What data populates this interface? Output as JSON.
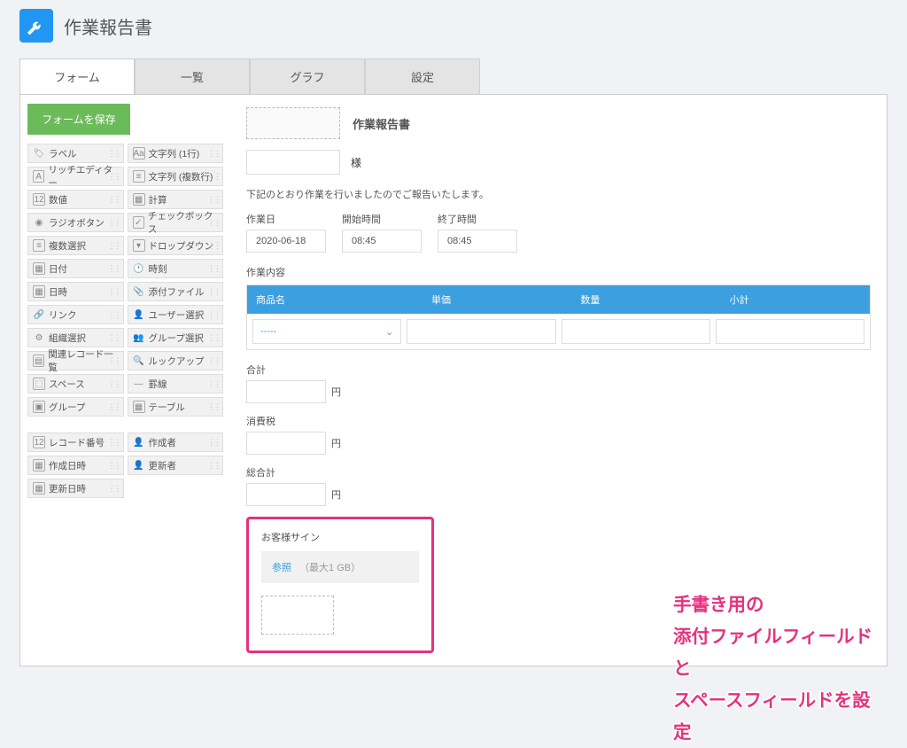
{
  "header": {
    "title": "作業報告書"
  },
  "tabs": {
    "form": "フォーム",
    "list": "一覧",
    "graph": "グラフ",
    "settings": "設定"
  },
  "sidebar": {
    "save": "フォームを保存",
    "fields": {
      "label": "ラベル",
      "text1": "文字列 (1行)",
      "rich": "リッチエディター",
      "textm": "文字列 (複数行)",
      "num": "数値",
      "calc": "計算",
      "radio": "ラジオボタン",
      "check": "チェックボックス",
      "multi": "複数選択",
      "drop": "ドロップダウン",
      "date": "日付",
      "time": "時刻",
      "datetime": "日時",
      "attach": "添付ファイル",
      "link": "リンク",
      "user": "ユーザー選択",
      "org": "組織選択",
      "group": "グループ選択",
      "related": "関連レコード一覧",
      "lookup": "ルックアップ",
      "space": "スペース",
      "hr": "罫線",
      "grp": "グループ",
      "tbl": "テーブル",
      "recno": "レコード番号",
      "creator": "作成者",
      "ctime": "作成日時",
      "updater": "更新者",
      "utime": "更新日時"
    }
  },
  "doc": {
    "title": "作業報告書",
    "sama": "様",
    "desc": "下記のとおり作業を行いましたのでご報告いたします。",
    "workDate": {
      "label": "作業日",
      "value": "2020-06-18"
    },
    "startTime": {
      "label": "開始時間",
      "value": "08:45"
    },
    "endTime": {
      "label": "終了時間",
      "value": "08:45"
    },
    "workContent": "作業内容",
    "tbl": {
      "c1": "商品名",
      "c2": "単価",
      "c3": "数量",
      "c4": "小計",
      "selPlaceholder": "-----"
    },
    "total": {
      "label": "合計",
      "unit": "円"
    },
    "tax": {
      "label": "消費税",
      "unit": "円"
    },
    "grand": {
      "label": "総合計",
      "unit": "円"
    },
    "sign": {
      "label": "お客様サイン",
      "browse": "参照",
      "hint": "（最大1 GB）"
    }
  },
  "annotation": {
    "l1": "手書き用の",
    "l2": "添付ファイルフィールドと",
    "l3": "スペースフィールドを設定"
  }
}
